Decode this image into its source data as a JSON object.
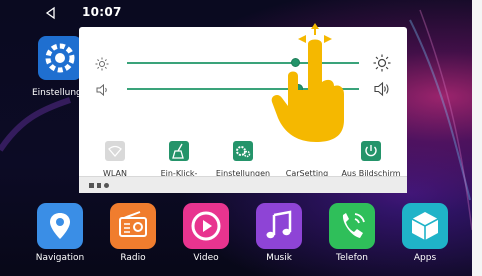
{
  "statusbar": {
    "time": "10:07"
  },
  "desktop": {
    "settings_label": "Einstellungen"
  },
  "quick_panel": {
    "brightness_level": 0.73,
    "volume_level": 0.74,
    "tiles": [
      {
        "id": "wlan",
        "label": "WLAN"
      },
      {
        "id": "cleanup",
        "label": "Ein-Klick-Bereinigung"
      },
      {
        "id": "settings",
        "label": "Einstellungen"
      },
      {
        "id": "carsetting",
        "label": "CarSetting"
      },
      {
        "id": "screen-off",
        "label": "Aus Bildschirm"
      }
    ]
  },
  "dock": [
    {
      "label": "Navigation",
      "color": "#3a8ee6"
    },
    {
      "label": "Radio",
      "color": "#f07d2e"
    },
    {
      "label": "Video",
      "color": "#e8348f"
    },
    {
      "label": "Musik",
      "color": "#8e44d6"
    },
    {
      "label": "Telefon",
      "color": "#2fbf5a"
    },
    {
      "label": "Apps",
      "color": "#1fb3c8"
    }
  ],
  "colors": {
    "accent": "#24946a",
    "hand": "#f5b800"
  }
}
